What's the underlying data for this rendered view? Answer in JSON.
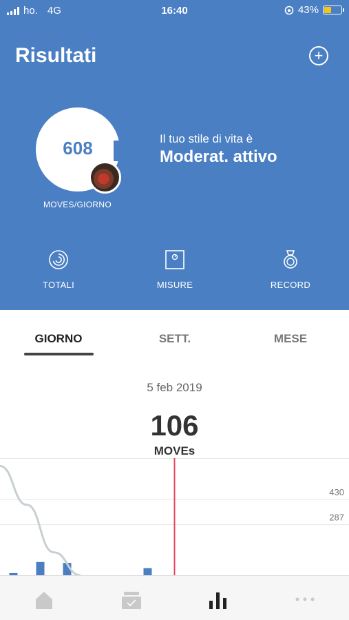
{
  "status": {
    "carrier": "ho.",
    "network": "4G",
    "time": "16:40",
    "battery": "43%",
    "battery_level": 0.43
  },
  "header": {
    "title": "Risultati",
    "add_icon": "plus-circle-icon"
  },
  "summary": {
    "daily_moves": "608",
    "daily_moves_caption": "MOVES/GIORNO",
    "lifestyle_label": "Il tuo stile di vita è",
    "lifestyle_value": "Moderat. attivo"
  },
  "quick_nav": [
    {
      "label": "TOTALI",
      "icon": "rings-icon"
    },
    {
      "label": "MISURE",
      "icon": "scale-icon"
    },
    {
      "label": "RECORD",
      "icon": "medal-icon"
    }
  ],
  "tabs": [
    {
      "label": "GIORNO",
      "active": true
    },
    {
      "label": "SETT.",
      "active": false
    },
    {
      "label": "MESE",
      "active": false
    }
  ],
  "day": {
    "date": "5 feb 2019",
    "moves": "106",
    "unit": "MOVEs"
  },
  "chart_data": {
    "type": "bar",
    "y_tick_labels": [
      "430",
      "287"
    ],
    "grid": true,
    "bars": [
      {
        "x": 0.5,
        "value": 12
      },
      {
        "x": 1.5,
        "value": 75
      },
      {
        "x": 2.5,
        "value": 70
      },
      {
        "x": 5.5,
        "value": 40
      }
    ],
    "trend_curve": [
      {
        "x": 0,
        "value": 620
      },
      {
        "x": 1,
        "value": 400
      },
      {
        "x": 2,
        "value": 130
      },
      {
        "x": 3,
        "value": 0
      }
    ],
    "selected_x": 6.5,
    "ylim": [
      0,
      665
    ],
    "xlim": [
      0,
      13
    ],
    "colors": {
      "bar": "#4a7fc3",
      "trend": "#c8cfd2",
      "marker": "#e8475f",
      "grid": "#e6e6e6"
    }
  },
  "bottom_nav": [
    {
      "icon": "home-icon",
      "active": false
    },
    {
      "icon": "inbox-icon",
      "active": false
    },
    {
      "icon": "bar-chart-icon",
      "active": true
    },
    {
      "icon": "more-icon",
      "active": false
    }
  ],
  "colors": {
    "brand": "#4a7fc3"
  }
}
